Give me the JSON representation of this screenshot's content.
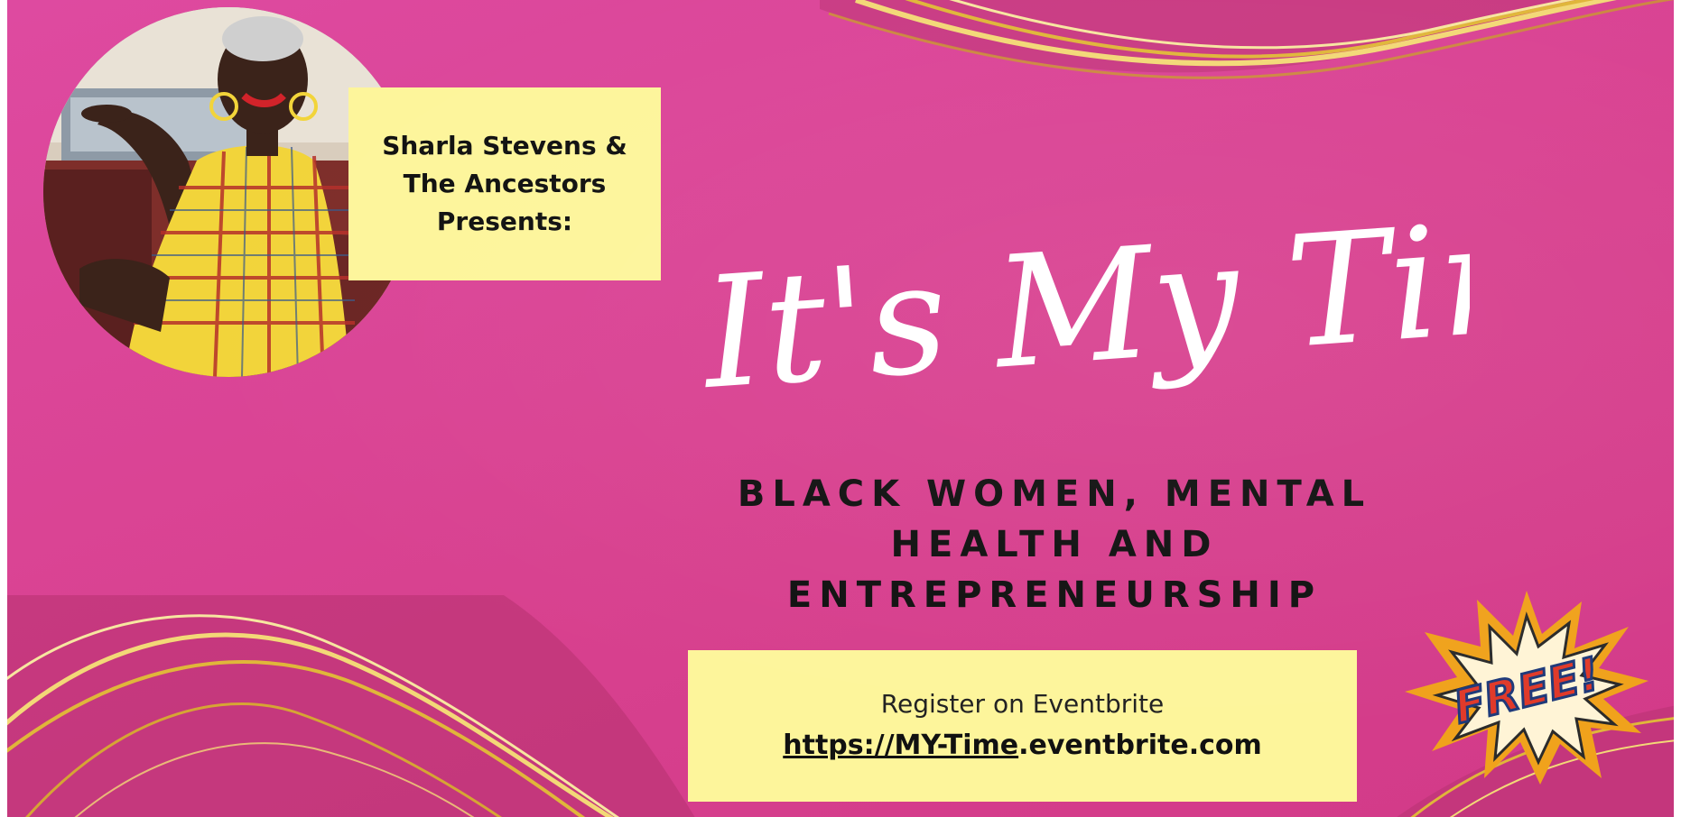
{
  "presenter": {
    "line1": "Sharla Stevens &",
    "line2": "The Ancestors",
    "line3": "Presents:"
  },
  "title": {
    "script": "It's My Time!"
  },
  "headline": {
    "line1": "BLACK WOMEN, MENTAL",
    "line2": "HEALTH AND",
    "line3": "ENTREPRENEURSHIP"
  },
  "register": {
    "label": "Register on Eventbrite",
    "url_underlined": "https://MY-Time",
    "url_rest": ".eventbrite.com"
  },
  "badge": {
    "text": "FREE!"
  },
  "colors": {
    "background": "#d8418f",
    "highlight_box": "#fdf59b",
    "gold": "#e8c24a",
    "title_text": "#ffffff",
    "headline_text": "#111111"
  },
  "icons": {
    "portrait": "portrait-photo",
    "waves": "gold-wave-ribbon",
    "burst": "starburst-badge"
  }
}
